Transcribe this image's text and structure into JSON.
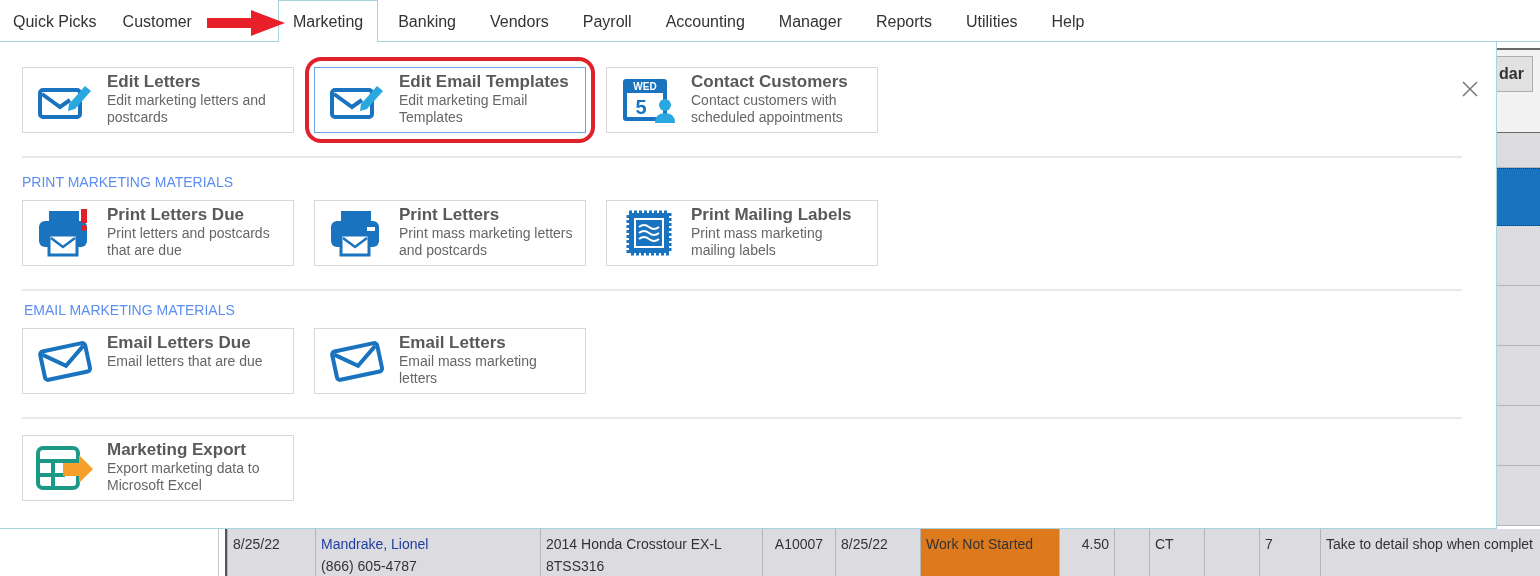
{
  "tabs": [
    {
      "label": "Quick Picks",
      "selected": false
    },
    {
      "label": "Customer",
      "selected": false
    },
    {
      "label": "Marketing",
      "selected": true
    },
    {
      "label": "Banking",
      "selected": false
    },
    {
      "label": "Vendors",
      "selected": false
    },
    {
      "label": "Payroll",
      "selected": false
    },
    {
      "label": "Accounting",
      "selected": false
    },
    {
      "label": "Manager",
      "selected": false
    },
    {
      "label": "Reports",
      "selected": false
    },
    {
      "label": "Utilities",
      "selected": false
    },
    {
      "label": "Help",
      "selected": false
    }
  ],
  "panel": {
    "groups": [
      {
        "tiles": [
          {
            "kind": "compose",
            "title": "Edit Letters",
            "description": "Edit marketing letters and postcards",
            "highlighted": false
          },
          {
            "kind": "compose",
            "title": "Edit Email Templates",
            "description": "Edit marketing Email Templates",
            "highlighted": true
          },
          {
            "kind": "calendar",
            "title": "Contact Customers",
            "description": "Contact customers with scheduled appointments",
            "highlighted": false,
            "icon_day": "WED",
            "icon_date": "5"
          }
        ]
      },
      {
        "heading": "PRINT MARKETING MATERIALS",
        "tiles": [
          {
            "kind": "alert",
            "title": "Print Letters Due",
            "description": "Print letters and postcards that are due",
            "highlighted": false
          },
          {
            "kind": "printer",
            "title": "Print Letters",
            "description": "Print mass marketing letters and postcards",
            "highlighted": false
          },
          {
            "kind": "stamp",
            "title": "Print Mailing Labels",
            "description": "Print mass marketing mailing labels",
            "highlighted": false
          }
        ]
      },
      {
        "heading": "EMAIL MARKETING MATERIALS",
        "tiles": [
          {
            "kind": "envelope",
            "title": "Email Letters Due",
            "description": "Email letters that are due",
            "highlighted": false
          },
          {
            "kind": "envelope",
            "title": "Email Letters",
            "description": "Email mass marketing letters",
            "highlighted": false
          }
        ]
      },
      {
        "tiles": [
          {
            "kind": "export",
            "title": "Marketing Export",
            "description": "Export marketing data to Microsoft Excel",
            "highlighted": false
          }
        ]
      }
    ]
  },
  "toolbar": {
    "button": "dar"
  },
  "side_rows": [
    {
      "selected": false
    },
    {
      "selected": true
    },
    {
      "selected": false
    },
    {
      "selected": false
    },
    {
      "selected": false
    },
    {
      "selected": false
    },
    {
      "selected": false
    }
  ],
  "table_row": {
    "cells": [
      {
        "kind": "text",
        "lines": [
          "8/25/22"
        ]
      },
      {
        "kind": "link",
        "lines": [
          "Mandrake, Lionel",
          "(866) 605-4787"
        ]
      },
      {
        "kind": "text",
        "lines": [
          "2014 Honda  Crosstour EX-L",
          "8TSS316"
        ]
      },
      {
        "kind": "center",
        "lines": [
          "A10007"
        ]
      },
      {
        "kind": "text",
        "lines": [
          "8/25/22"
        ]
      },
      {
        "kind": "status",
        "lines": [
          "Work Not Started"
        ],
        "color": "#dd7a1e"
      },
      {
        "kind": "number",
        "lines": [
          "4.50"
        ]
      },
      {
        "kind": "empty"
      },
      {
        "kind": "text",
        "lines": [
          "CT"
        ]
      },
      {
        "kind": "empty"
      },
      {
        "kind": "text",
        "lines": [
          "7"
        ]
      },
      {
        "kind": "text",
        "lines": [
          "Take to detail shop when complet"
        ]
      }
    ]
  }
}
